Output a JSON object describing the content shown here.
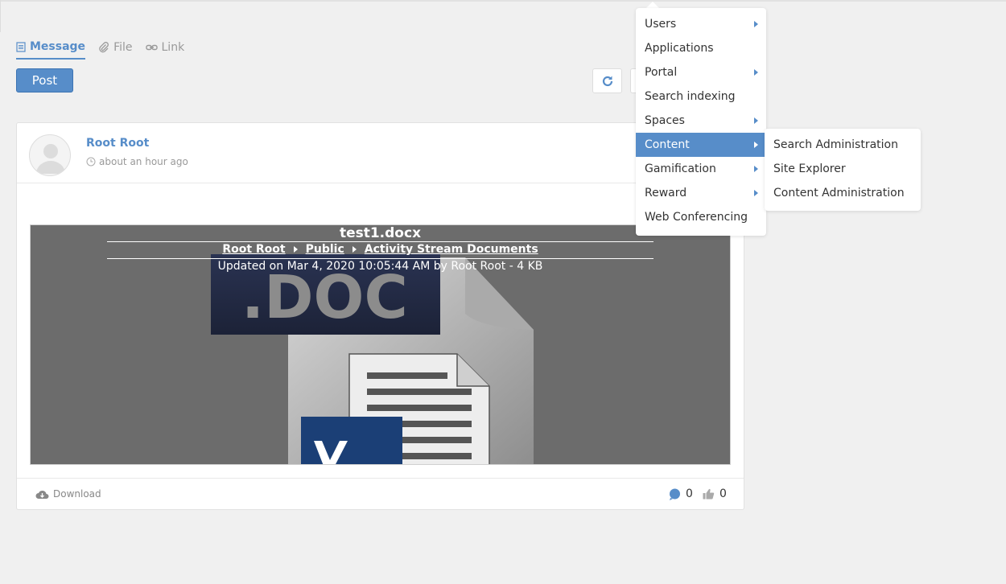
{
  "composer": {
    "tabs": [
      {
        "label": "Message",
        "icon": "message-icon",
        "active": true
      },
      {
        "label": "File",
        "icon": "paperclip-icon",
        "active": false
      },
      {
        "label": "Link",
        "icon": "link-icon",
        "active": false
      }
    ],
    "post_label": "Post"
  },
  "activity": {
    "author": "Root Root",
    "time": "about an hour ago",
    "file": {
      "title": "test1.docx",
      "breadcrumb": [
        "Root Root",
        "Public",
        "Activity Stream Documents"
      ],
      "updated": "Updated on Mar 4, 2020 10:05:44 AM by Root Root - 4 KB",
      "preview_art_text": ".DOC"
    },
    "footer": {
      "download_label": "Download",
      "comments": "0",
      "likes": "0"
    }
  },
  "admin_menu": {
    "items": [
      {
        "label": "Users",
        "has_submenu": true
      },
      {
        "label": "Applications",
        "has_submenu": false
      },
      {
        "label": "Portal",
        "has_submenu": true
      },
      {
        "label": "Search indexing",
        "has_submenu": false
      },
      {
        "label": "Spaces",
        "has_submenu": true
      },
      {
        "label": "Content",
        "has_submenu": true,
        "active": true
      },
      {
        "label": "Gamification",
        "has_submenu": true
      },
      {
        "label": "Reward",
        "has_submenu": true
      },
      {
        "label": "Web Conferencing",
        "has_submenu": false
      }
    ],
    "content_submenu": [
      {
        "label": "Search Administration"
      },
      {
        "label": "Site Explorer"
      },
      {
        "label": "Content Administration"
      }
    ]
  },
  "colors": {
    "accent": "#578dc9",
    "background": "#f0f0f0",
    "muted": "#999999"
  }
}
